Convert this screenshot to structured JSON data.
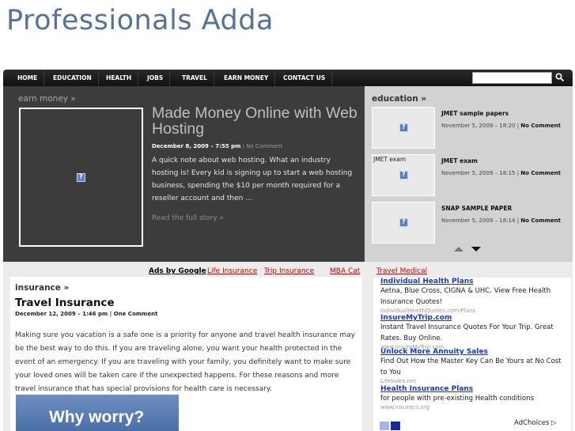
{
  "site": {
    "logo": "Professionals Adda"
  },
  "nav": {
    "items": [
      "HOME",
      "EDUCATION",
      "HEALTH",
      "JOBS",
      "TRAVEL",
      "EARN MONEY",
      "CONTACT US"
    ],
    "search_placeholder": ""
  },
  "featured": {
    "category": "earn money »",
    "title": "Made Money Online with Web Hosting",
    "date": "December 8, 2009 – 7:55 pm",
    "separator": " | ",
    "comments": "No Comment",
    "excerpt": "A quick note about web hosting. What an industry hosting is! Every kid is signing up to start a web hosting business, spending the $10 per month required for a reseller account and then …",
    "read_more": "Read the full story »"
  },
  "side": {
    "category": "education »",
    "posts": [
      {
        "title": "JMET sample papers",
        "date": "November 5, 2009 – 18:20",
        "comments": "No Comment",
        "thumb_caption": ""
      },
      {
        "title": "JMET exam",
        "date": "November 5, 2009 – 18:15",
        "comments": "No Comment",
        "thumb_caption": "JMET exam"
      },
      {
        "title": "SNAP SAMPLE PAPER",
        "date": "November 5, 2009 – 18:14",
        "comments": "No Comment",
        "thumb_caption": ""
      }
    ]
  },
  "ads_bar": {
    "label": "Ads by Google",
    "links": [
      "Life Insurance",
      "Trip Insurance",
      "MBA Cat",
      "Travel Medical"
    ]
  },
  "post": {
    "category": "insurance »",
    "title": "Travel Insurance",
    "date": "December 12, 2009 – 1:46 pm",
    "separator": " | ",
    "comments": "One Comment",
    "body": "Making sure you vacation is a safe one is a priority for anyone and travel health insurance may be the best way to do this. If you are traveling alone, you want your health protected in the event of an emergency. If you are traveling with your family, you definitely want to make sure your loved ones will be taken care if the unexpected happens. For these reasons and more travel insurance that has special provisions for health care is necessary.",
    "promo_text": "Why worry?"
  },
  "ads": [
    {
      "title": "Individual Health Plans",
      "text": "Aetna, Blue Cross, CIGNA & UHC. View Free Health Insurance Quotes!",
      "url": "IndividualHealthQuotes.com/Plans"
    },
    {
      "title": "InsureMyTrip.com",
      "text": "Instant Travel Insurance Quotes For Your Trip. Great Rates. Buy Online.",
      "url": "www.InsureMyTrip.com"
    },
    {
      "title": "Unlock More Annuity Sales",
      "text": "Find Out How the Master Key Can Be Yours at No Cost to You",
      "url": "LifeSales.net"
    },
    {
      "title": "Health Insurance Plans",
      "text": "for people with pre-existing Health conditions",
      "url": "www.Insureco.org"
    }
  ],
  "adchoices": "AdChoices ▷",
  "colors": {
    "logo": "#56729a",
    "featured_bg": "#3c3c3c",
    "side_bg": "#d2d2d2",
    "ad_link": "#1a36c8",
    "ads_bar_link": "#cc0000"
  }
}
